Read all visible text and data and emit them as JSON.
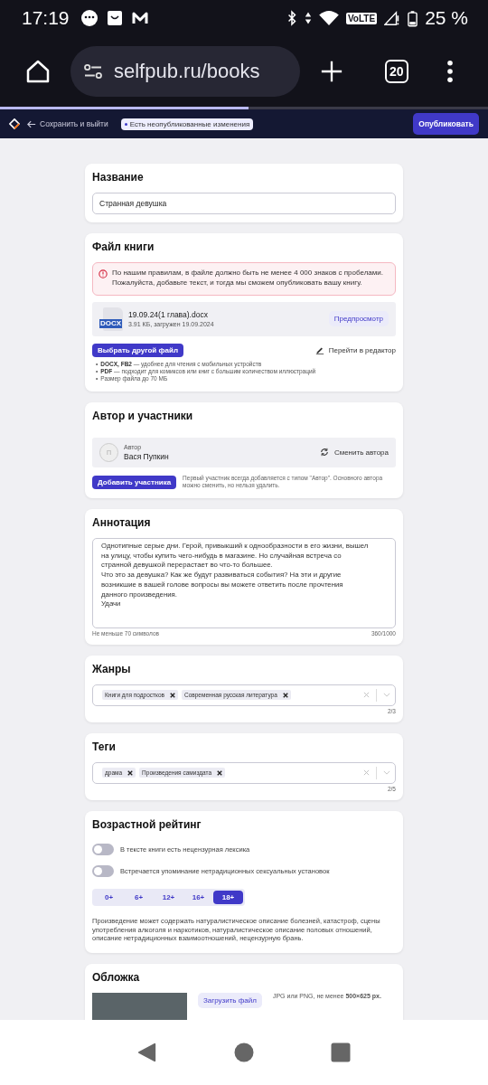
{
  "status_bar": {
    "time": "17:19",
    "network": "VoLTE",
    "battery": "25 %"
  },
  "browser": {
    "url": "selfpub.ru/books",
    "tab_count": "20",
    "load": {
      "level": 0.51
    }
  },
  "header": {
    "back": "Сохранить и выйти",
    "badge": "Есть неопубликованные изменения",
    "publish": "Опубликовать"
  },
  "title_card": {
    "heading": "Название",
    "value": "Странная девушка"
  },
  "file_card": {
    "heading": "Файл книги",
    "alert": "По нашим правилам, в файле должно быть не менее 4 000 знаков с пробелами. Пожалуйста, добавьте текст, и тогда мы сможем опубликовать вашу книгу.",
    "file_badge": "DOCX",
    "file_name": "19.09.24(1 глава).docx",
    "file_meta": "3.91 КБ, загружен 19.09.2024",
    "preview": "Предпросмотр",
    "choose": "Выбрать другой файл",
    "editor": "Перейти в редактор",
    "formats": [
      {
        "marker": "•",
        "bold": "DOCX, FB2",
        "text": "— удобнее для чтения с мобильных устройств"
      },
      {
        "marker": "•",
        "bold": "PDF",
        "text": "— подходит для комиксов или книг с большим количеством иллюстраций"
      },
      {
        "marker": "•",
        "text": "Размер файла до 70 МБ"
      }
    ]
  },
  "author_card": {
    "heading": "Автор и участники",
    "avatar": "П",
    "role": "Автор",
    "name": "Вася Пупкин",
    "change": "Сменить автора",
    "add": "Добавить участника",
    "note": "Первый участник всегда добавляется с типом \"Автор\". Основного автора можно сменить, но нельзя удалить."
  },
  "annotation_card": {
    "heading": "Аннотация",
    "value": "Однотипные серые дни. Герой, привыкший к однообразности в его жизни, вышел на улицу, чтобы купить чего-нибудь в магазине. Но случайная встреча со странной девушкой перерастает во что-то большее.\nЧто это за девушка? Как же будут развиваться события? На эти и другие возникшие в вашей голове вопросы вы можете ответить после прочтения данного произведения.\nУдачи",
    "hint": "Не меньше 70 символов",
    "count": "360/1000"
  },
  "genres_card": {
    "heading": "Жанры",
    "chips": [
      "Книги для подростков",
      "Современная русская литература"
    ],
    "count": "2/3"
  },
  "tags_card": {
    "heading": "Теги",
    "chips": [
      "драма",
      "Произведения самиздата"
    ],
    "count": "2/5"
  },
  "rating_card": {
    "heading": "Возрастной рейтинг",
    "toggles": [
      {
        "label": "В тексте книги есть нецензурная лексика",
        "on": false
      },
      {
        "label": "Встречается упоминание нетрадиционных сексуальных установок",
        "on": false
      }
    ],
    "ratings": [
      {
        "label": "0+",
        "selected": false
      },
      {
        "label": "6+",
        "selected": false
      },
      {
        "label": "12+",
        "selected": false
      },
      {
        "label": "16+",
        "selected": false
      },
      {
        "label": "18+",
        "selected": true
      }
    ],
    "description": "Произведение может содержать натуралистическое описание болезней, катастроф, сцены употребления алкоголя и наркотиков, натуралистическое описание половых отношений, описание нетрадиционных взаимоотношений, нецензурную брань."
  },
  "cover_card": {
    "heading": "Обложка",
    "upload": "Загрузить файл",
    "hint": "JPG или PNG, не менее **500×625 px.**"
  }
}
